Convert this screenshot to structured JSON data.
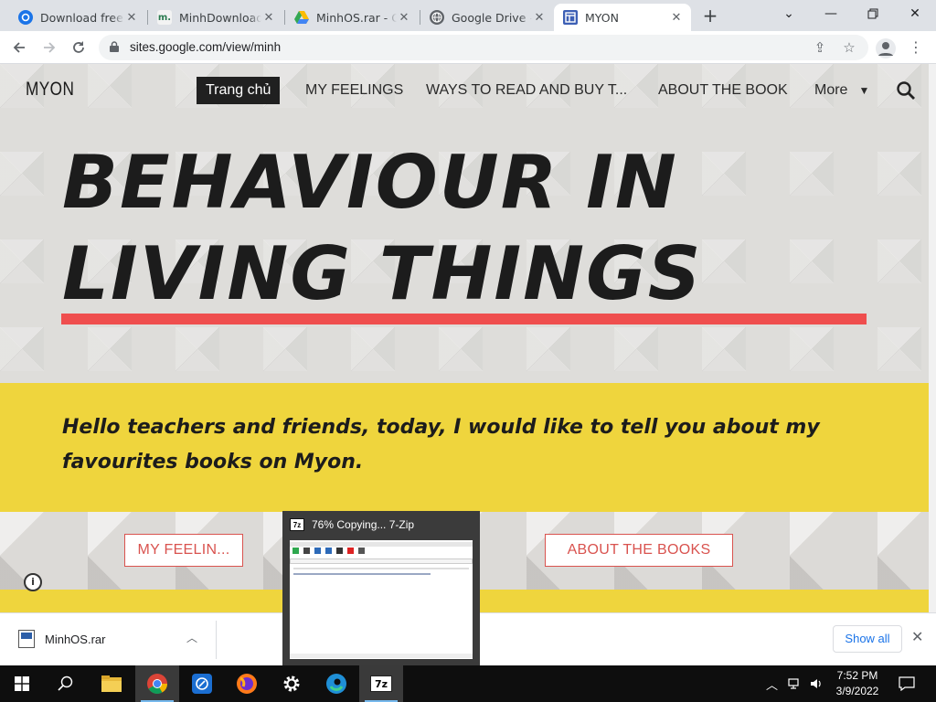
{
  "browser": {
    "tabs": [
      {
        "title": "Download free r",
        "favicon": "edge-blue-icon",
        "active": false
      },
      {
        "title": "MinhDownload",
        "favicon": "m-site-icon",
        "active": false
      },
      {
        "title": "MinhOS.rar - Go",
        "favicon": "google-drive-icon",
        "active": false
      },
      {
        "title": "Google Drive - Đ",
        "favicon": "globe-icon",
        "active": false
      },
      {
        "title": "MYON",
        "favicon": "google-sites-icon",
        "active": true
      }
    ],
    "url": "sites.google.com/view/minh"
  },
  "site": {
    "logo": "MYON",
    "nav": {
      "home": "Trang chủ",
      "feelings": "MY FEELINGS",
      "ways": "WAYS TO READ AND BUY T...",
      "about": "ABOUT THE BOOK",
      "more": "More"
    },
    "title_line1": "BEHAVIOUR IN",
    "title_line2": "LIVING THINGS",
    "intro": "Hello teachers and friends, today, I would like to tell you about my favourites books on Myon.",
    "button_feelings": "MY FEELIN...",
    "button_about": "ABOUT THE BOOKS",
    "accent_color": "#ef4e4e",
    "band_color": "#efd53d"
  },
  "downloads": {
    "file_name": "MinhOS.rar",
    "show_all": "Show all"
  },
  "preview": {
    "title": "76% Copying... 7-Zip",
    "app_icon_text": "7z"
  },
  "taskbar": {
    "time": "7:52 PM",
    "date": "3/9/2022"
  }
}
